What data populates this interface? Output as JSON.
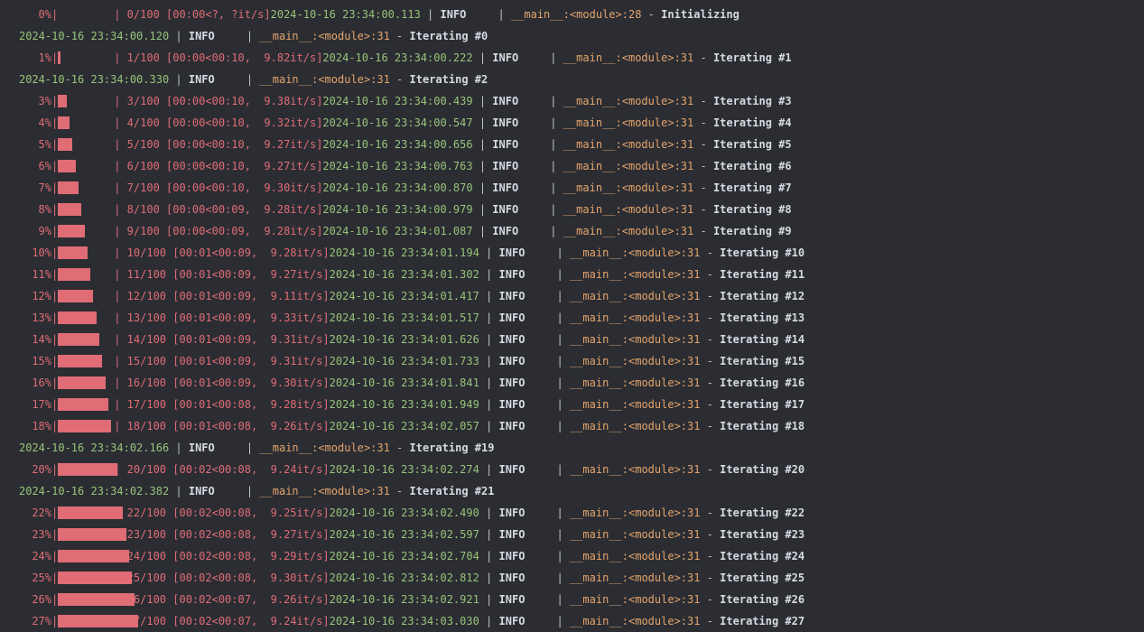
{
  "console": {
    "colors": {
      "background": "#2b2d33",
      "progress": "#e06c75",
      "timestamp": "#98c379",
      "module": "#e5a46b",
      "text": "#d7dae0"
    },
    "lines": [
      {
        "type": "progress",
        "percent": "0%",
        "fill": 0.0,
        "count": "0/100",
        "timing": "[00:00<?, ?it/s]",
        "timestamp": "2024-10-16 23:34:00.113",
        "level": "INFO",
        "module": "__main__:<module>",
        "line_no": "28",
        "message": "Initializing"
      },
      {
        "type": "log",
        "timestamp": "2024-10-16 23:34:00.120",
        "level": "INFO",
        "module": "__main__:<module>",
        "line_no": "31",
        "message": "Iterating #0"
      },
      {
        "type": "progress",
        "percent": "1%",
        "fill": 0.01,
        "count": "1/100",
        "timing": "[00:00<00:10,  9.82it/s]",
        "timestamp": "2024-10-16 23:34:00.222",
        "level": "INFO",
        "module": "__main__:<module>",
        "line_no": "31",
        "message": "Iterating #1"
      },
      {
        "type": "log",
        "timestamp": "2024-10-16 23:34:00.330",
        "level": "INFO",
        "module": "__main__:<module>",
        "line_no": "31",
        "message": "Iterating #2"
      },
      {
        "type": "progress",
        "percent": "3%",
        "fill": 0.03,
        "count": "3/100",
        "timing": "[00:00<00:10,  9.38it/s]",
        "timestamp": "2024-10-16 23:34:00.439",
        "level": "INFO",
        "module": "__main__:<module>",
        "line_no": "31",
        "message": "Iterating #3"
      },
      {
        "type": "progress",
        "percent": "4%",
        "fill": 0.04,
        "count": "4/100",
        "timing": "[00:00<00:10,  9.32it/s]",
        "timestamp": "2024-10-16 23:34:00.547",
        "level": "INFO",
        "module": "__main__:<module>",
        "line_no": "31",
        "message": "Iterating #4"
      },
      {
        "type": "progress",
        "percent": "5%",
        "fill": 0.05,
        "count": "5/100",
        "timing": "[00:00<00:10,  9.27it/s]",
        "timestamp": "2024-10-16 23:34:00.656",
        "level": "INFO",
        "module": "__main__:<module>",
        "line_no": "31",
        "message": "Iterating #5"
      },
      {
        "type": "progress",
        "percent": "6%",
        "fill": 0.06,
        "count": "6/100",
        "timing": "[00:00<00:10,  9.27it/s]",
        "timestamp": "2024-10-16 23:34:00.763",
        "level": "INFO",
        "module": "__main__:<module>",
        "line_no": "31",
        "message": "Iterating #6"
      },
      {
        "type": "progress",
        "percent": "7%",
        "fill": 0.07,
        "count": "7/100",
        "timing": "[00:00<00:10,  9.30it/s]",
        "timestamp": "2024-10-16 23:34:00.870",
        "level": "INFO",
        "module": "__main__:<module>",
        "line_no": "31",
        "message": "Iterating #7"
      },
      {
        "type": "progress",
        "percent": "8%",
        "fill": 0.08,
        "count": "8/100",
        "timing": "[00:00<00:09,  9.28it/s]",
        "timestamp": "2024-10-16 23:34:00.979",
        "level": "INFO",
        "module": "__main__:<module>",
        "line_no": "31",
        "message": "Iterating #8"
      },
      {
        "type": "progress",
        "percent": "9%",
        "fill": 0.09,
        "count": "9/100",
        "timing": "[00:00<00:09,  9.28it/s]",
        "timestamp": "2024-10-16 23:34:01.087",
        "level": "INFO",
        "module": "__main__:<module>",
        "line_no": "31",
        "message": "Iterating #9"
      },
      {
        "type": "progress",
        "percent": "10%",
        "fill": 0.1,
        "count": "10/100",
        "timing": "[00:01<00:09,  9.28it/s]",
        "timestamp": "2024-10-16 23:34:01.194",
        "level": "INFO",
        "module": "__main__:<module>",
        "line_no": "31",
        "message": "Iterating #10"
      },
      {
        "type": "progress",
        "percent": "11%",
        "fill": 0.11,
        "count": "11/100",
        "timing": "[00:01<00:09,  9.27it/s]",
        "timestamp": "2024-10-16 23:34:01.302",
        "level": "INFO",
        "module": "__main__:<module>",
        "line_no": "31",
        "message": "Iterating #11"
      },
      {
        "type": "progress",
        "percent": "12%",
        "fill": 0.12,
        "count": "12/100",
        "timing": "[00:01<00:09,  9.11it/s]",
        "timestamp": "2024-10-16 23:34:01.417",
        "level": "INFO",
        "module": "__main__:<module>",
        "line_no": "31",
        "message": "Iterating #12"
      },
      {
        "type": "progress",
        "percent": "13%",
        "fill": 0.13,
        "count": "13/100",
        "timing": "[00:01<00:09,  9.33it/s]",
        "timestamp": "2024-10-16 23:34:01.517",
        "level": "INFO",
        "module": "__main__:<module>",
        "line_no": "31",
        "message": "Iterating #13"
      },
      {
        "type": "progress",
        "percent": "14%",
        "fill": 0.14,
        "count": "14/100",
        "timing": "[00:01<00:09,  9.31it/s]",
        "timestamp": "2024-10-16 23:34:01.626",
        "level": "INFO",
        "module": "__main__:<module>",
        "line_no": "31",
        "message": "Iterating #14"
      },
      {
        "type": "progress",
        "percent": "15%",
        "fill": 0.15,
        "count": "15/100",
        "timing": "[00:01<00:09,  9.31it/s]",
        "timestamp": "2024-10-16 23:34:01.733",
        "level": "INFO",
        "module": "__main__:<module>",
        "line_no": "31",
        "message": "Iterating #15"
      },
      {
        "type": "progress",
        "percent": "16%",
        "fill": 0.16,
        "count": "16/100",
        "timing": "[00:01<00:09,  9.30it/s]",
        "timestamp": "2024-10-16 23:34:01.841",
        "level": "INFO",
        "module": "__main__:<module>",
        "line_no": "31",
        "message": "Iterating #16"
      },
      {
        "type": "progress",
        "percent": "17%",
        "fill": 0.17,
        "count": "17/100",
        "timing": "[00:01<00:08,  9.28it/s]",
        "timestamp": "2024-10-16 23:34:01.949",
        "level": "INFO",
        "module": "__main__:<module>",
        "line_no": "31",
        "message": "Iterating #17"
      },
      {
        "type": "progress",
        "percent": "18%",
        "fill": 0.18,
        "count": "18/100",
        "timing": "[00:01<00:08,  9.26it/s]",
        "timestamp": "2024-10-16 23:34:02.057",
        "level": "INFO",
        "module": "__main__:<module>",
        "line_no": "31",
        "message": "Iterating #18"
      },
      {
        "type": "log",
        "timestamp": "2024-10-16 23:34:02.166",
        "level": "INFO",
        "module": "__main__:<module>",
        "line_no": "31",
        "message": "Iterating #19"
      },
      {
        "type": "progress",
        "percent": "20%",
        "fill": 0.2,
        "count": "20/100",
        "timing": "[00:02<00:08,  9.24it/s]",
        "timestamp": "2024-10-16 23:34:02.274",
        "level": "INFO",
        "module": "__main__:<module>",
        "line_no": "31",
        "message": "Iterating #20"
      },
      {
        "type": "log",
        "timestamp": "2024-10-16 23:34:02.382",
        "level": "INFO",
        "module": "__main__:<module>",
        "line_no": "31",
        "message": "Iterating #21"
      },
      {
        "type": "progress",
        "percent": "22%",
        "fill": 0.22,
        "count": "22/100",
        "timing": "[00:02<00:08,  9.25it/s]",
        "timestamp": "2024-10-16 23:34:02.490",
        "level": "INFO",
        "module": "__main__:<module>",
        "line_no": "31",
        "message": "Iterating #22"
      },
      {
        "type": "progress",
        "percent": "23%",
        "fill": 0.23,
        "count": "23/100",
        "timing": "[00:02<00:08,  9.27it/s]",
        "timestamp": "2024-10-16 23:34:02.597",
        "level": "INFO",
        "module": "__main__:<module>",
        "line_no": "31",
        "message": "Iterating #23"
      },
      {
        "type": "progress",
        "percent": "24%",
        "fill": 0.24,
        "count": "24/100",
        "timing": "[00:02<00:08,  9.29it/s]",
        "timestamp": "2024-10-16 23:34:02.704",
        "level": "INFO",
        "module": "__main__:<module>",
        "line_no": "31",
        "message": "Iterating #24"
      },
      {
        "type": "progress",
        "percent": "25%",
        "fill": 0.25,
        "count": "25/100",
        "timing": "[00:02<00:08,  9.30it/s]",
        "timestamp": "2024-10-16 23:34:02.812",
        "level": "INFO",
        "module": "__main__:<module>",
        "line_no": "31",
        "message": "Iterating #25"
      },
      {
        "type": "progress",
        "percent": "26%",
        "fill": 0.26,
        "count": "26/100",
        "timing": "[00:02<00:07,  9.26it/s]",
        "timestamp": "2024-10-16 23:34:02.921",
        "level": "INFO",
        "module": "__main__:<module>",
        "line_no": "31",
        "message": "Iterating #26"
      },
      {
        "type": "progress",
        "percent": "27%",
        "fill": 0.27,
        "count": "27/100",
        "timing": "[00:02<00:07,  9.24it/s]",
        "timestamp": "2024-10-16 23:34:03.030",
        "level": "INFO",
        "module": "__main__:<module>",
        "line_no": "31",
        "message": "Iterating #27"
      }
    ]
  }
}
